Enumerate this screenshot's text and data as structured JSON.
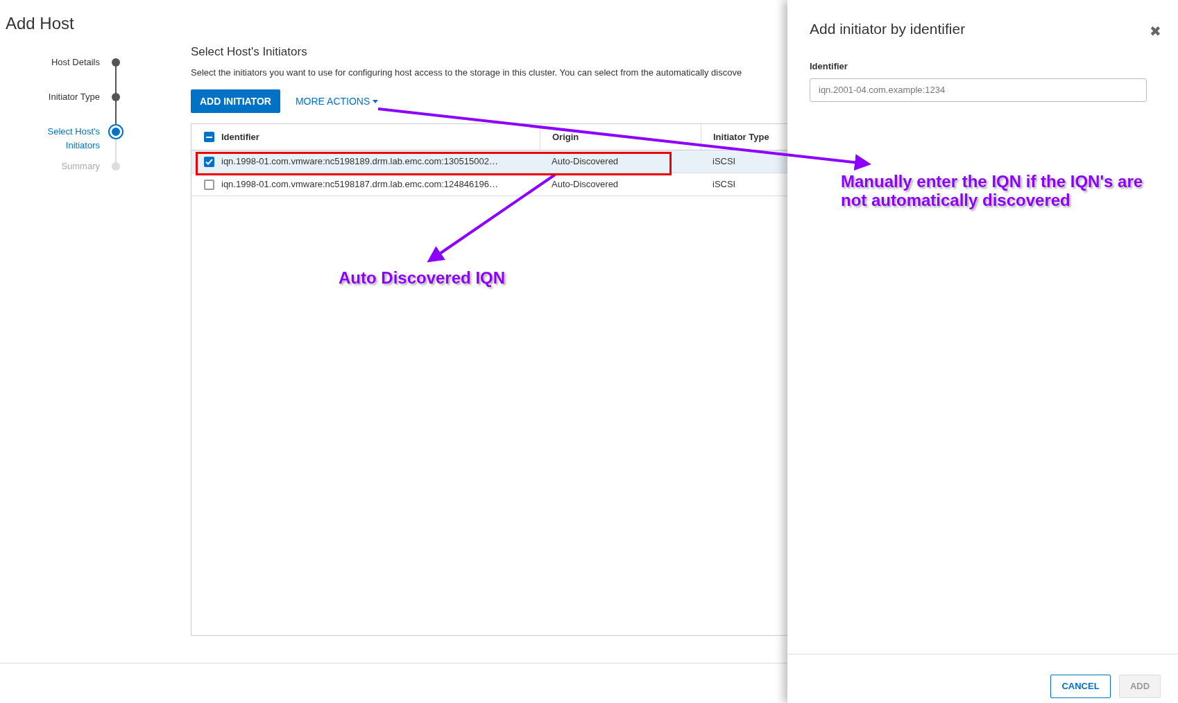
{
  "page": {
    "title": "Add Host"
  },
  "steps": [
    {
      "label": "Host Details",
      "completed": true,
      "selected": false
    },
    {
      "label": "Initiator Type",
      "completed": true,
      "selected": false
    },
    {
      "label": "Select Host's Initiators",
      "completed": false,
      "selected": true
    },
    {
      "label": "Summary",
      "completed": false,
      "selected": false
    }
  ],
  "section": {
    "title": "Select Host's Initiators",
    "description": "Select the initiators you want to use for configuring host access to the storage in this cluster. You can select from the automatically discove"
  },
  "toolbar": {
    "primary": "ADD INITIATOR",
    "more": "MORE ACTIONS"
  },
  "table": {
    "select_all_indeterminate": true,
    "columns": [
      "Identifier",
      "Origin",
      "Initiator Type"
    ],
    "rows": [
      {
        "cells": [
          "iqn.1998-01.com.vmware:nc5198189.drm.lab.emc.com:130515002…",
          "Auto-Discovered",
          "iSCSI"
        ],
        "selected": true,
        "highlighted": true
      },
      {
        "cells": [
          "iqn.1998-01.com.vmware:nc5198187.drm.lab.emc.com:124846196…",
          "Auto-Discovered",
          "iSCSI"
        ],
        "selected": false,
        "highlighted": false
      }
    ]
  },
  "panel": {
    "title": "Add initiator by identifier",
    "close": "✖",
    "field_label": "Identifier",
    "placeholder": "iqn.2001-04.com.example:1234",
    "buttons": [
      {
        "label": "CANCEL",
        "disabled": false
      },
      {
        "label": "ADD",
        "disabled": true
      }
    ]
  },
  "annotations": [
    {
      "text": "Auto Discovered IQN"
    },
    {
      "text": "Manually enter the IQN if the IQN's are not automatically discovered"
    }
  ]
}
